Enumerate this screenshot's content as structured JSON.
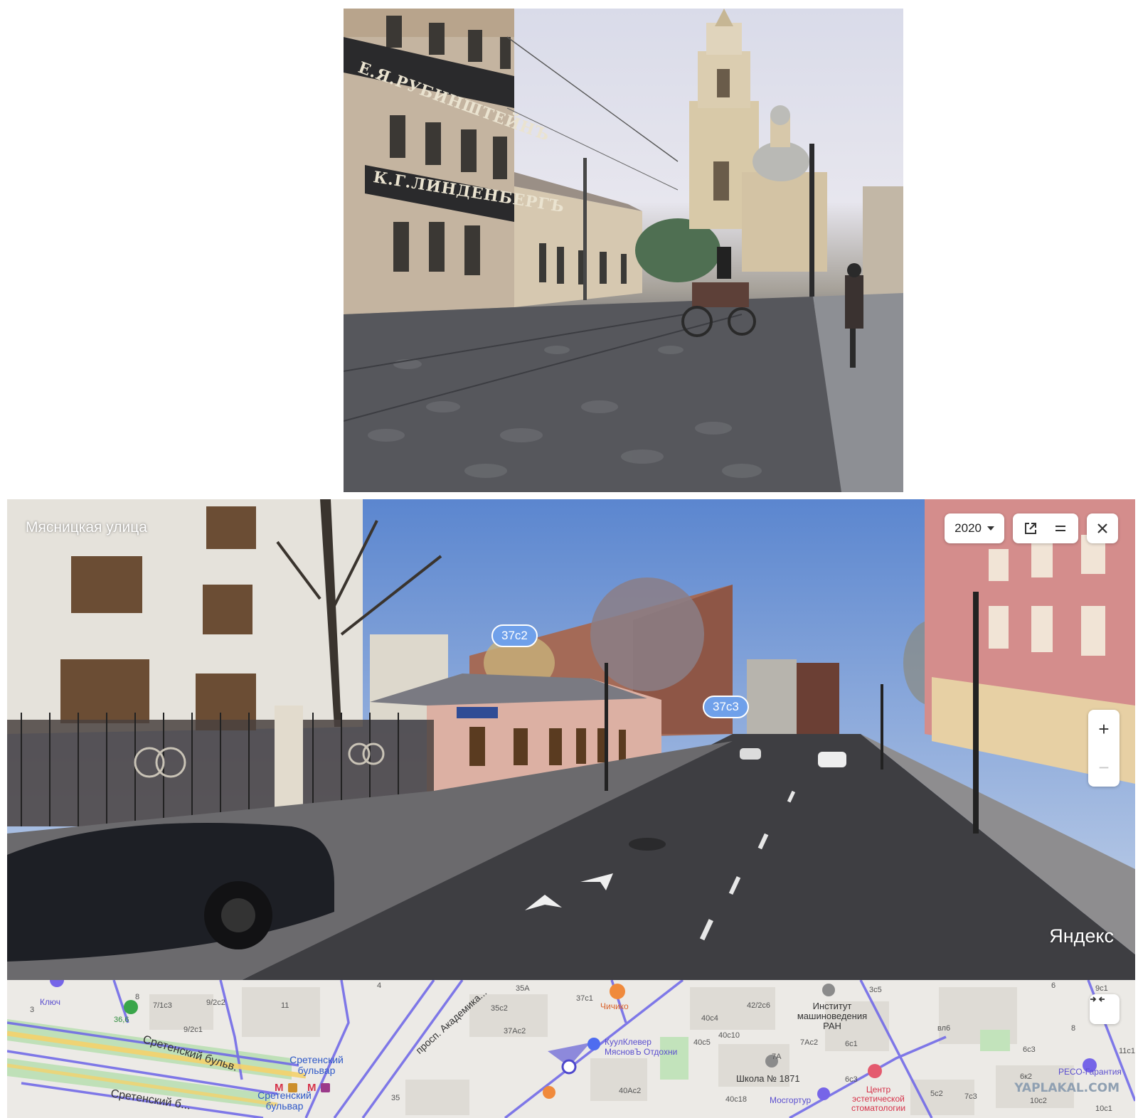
{
  "historic_photo": {
    "sign_top": "Е.Я.РУБИНШТЕЙНЪ",
    "sign_middle": "К.Г.ЛИНДЕНБЕРГЪ"
  },
  "panorama": {
    "street_title": "Мясницкая улица",
    "year": "2020",
    "house_labels": [
      "37с2",
      "37с3"
    ],
    "brand": "Яндекс"
  },
  "controls": {
    "icons": [
      "external-link-icon",
      "split-view-icon",
      "close-icon"
    ],
    "zoom_in": "+",
    "zoom_out": "−"
  },
  "map": {
    "collapse_icon": "collapse-arrows-icon",
    "streets": [
      "Сретенский бульв.",
      "Сретенский б...",
      "просп. Академика..."
    ],
    "pois": {
      "kluch": "Ключ",
      "pharmacy": "36,6",
      "chichiko": "Чичико",
      "kulkl": "КуулКлевер",
      "myasnov": "МясновЪ Отдохни",
      "institute": "Институт машиноведения РАН",
      "school": "Школа № 1871",
      "mosgortur": "Мосгортур",
      "center": "Центр эстетической стоматологии",
      "reso": "РЕСО-Гарантия",
      "metro1": "Сретенский бульвар",
      "metro2": "Сретенский бульвар"
    },
    "buildings": [
      "8",
      "7/1с3",
      "9/2с2",
      "11",
      "9/2с1",
      "3",
      "35А",
      "35с2",
      "37с1",
      "37Ас2",
      "40с4",
      "42/2с6",
      "40с10",
      "40с5",
      "7Ас2",
      "6с1",
      "3с5",
      "вл6",
      "8",
      "9с1",
      "11с1",
      "6с3",
      "7А",
      "6с3",
      "6к2",
      "10с2",
      "10с1",
      "5с2",
      "7с3",
      "40Ас2",
      "40с18",
      "35",
      "4",
      "6"
    ],
    "metro_lines": [
      "8",
      "7"
    ]
  },
  "watermark": "YAPLAKAL.COM",
  "colors": {
    "house_label": "#6fa0ea",
    "route": "#6b64e8",
    "metro": "#d6334a"
  }
}
